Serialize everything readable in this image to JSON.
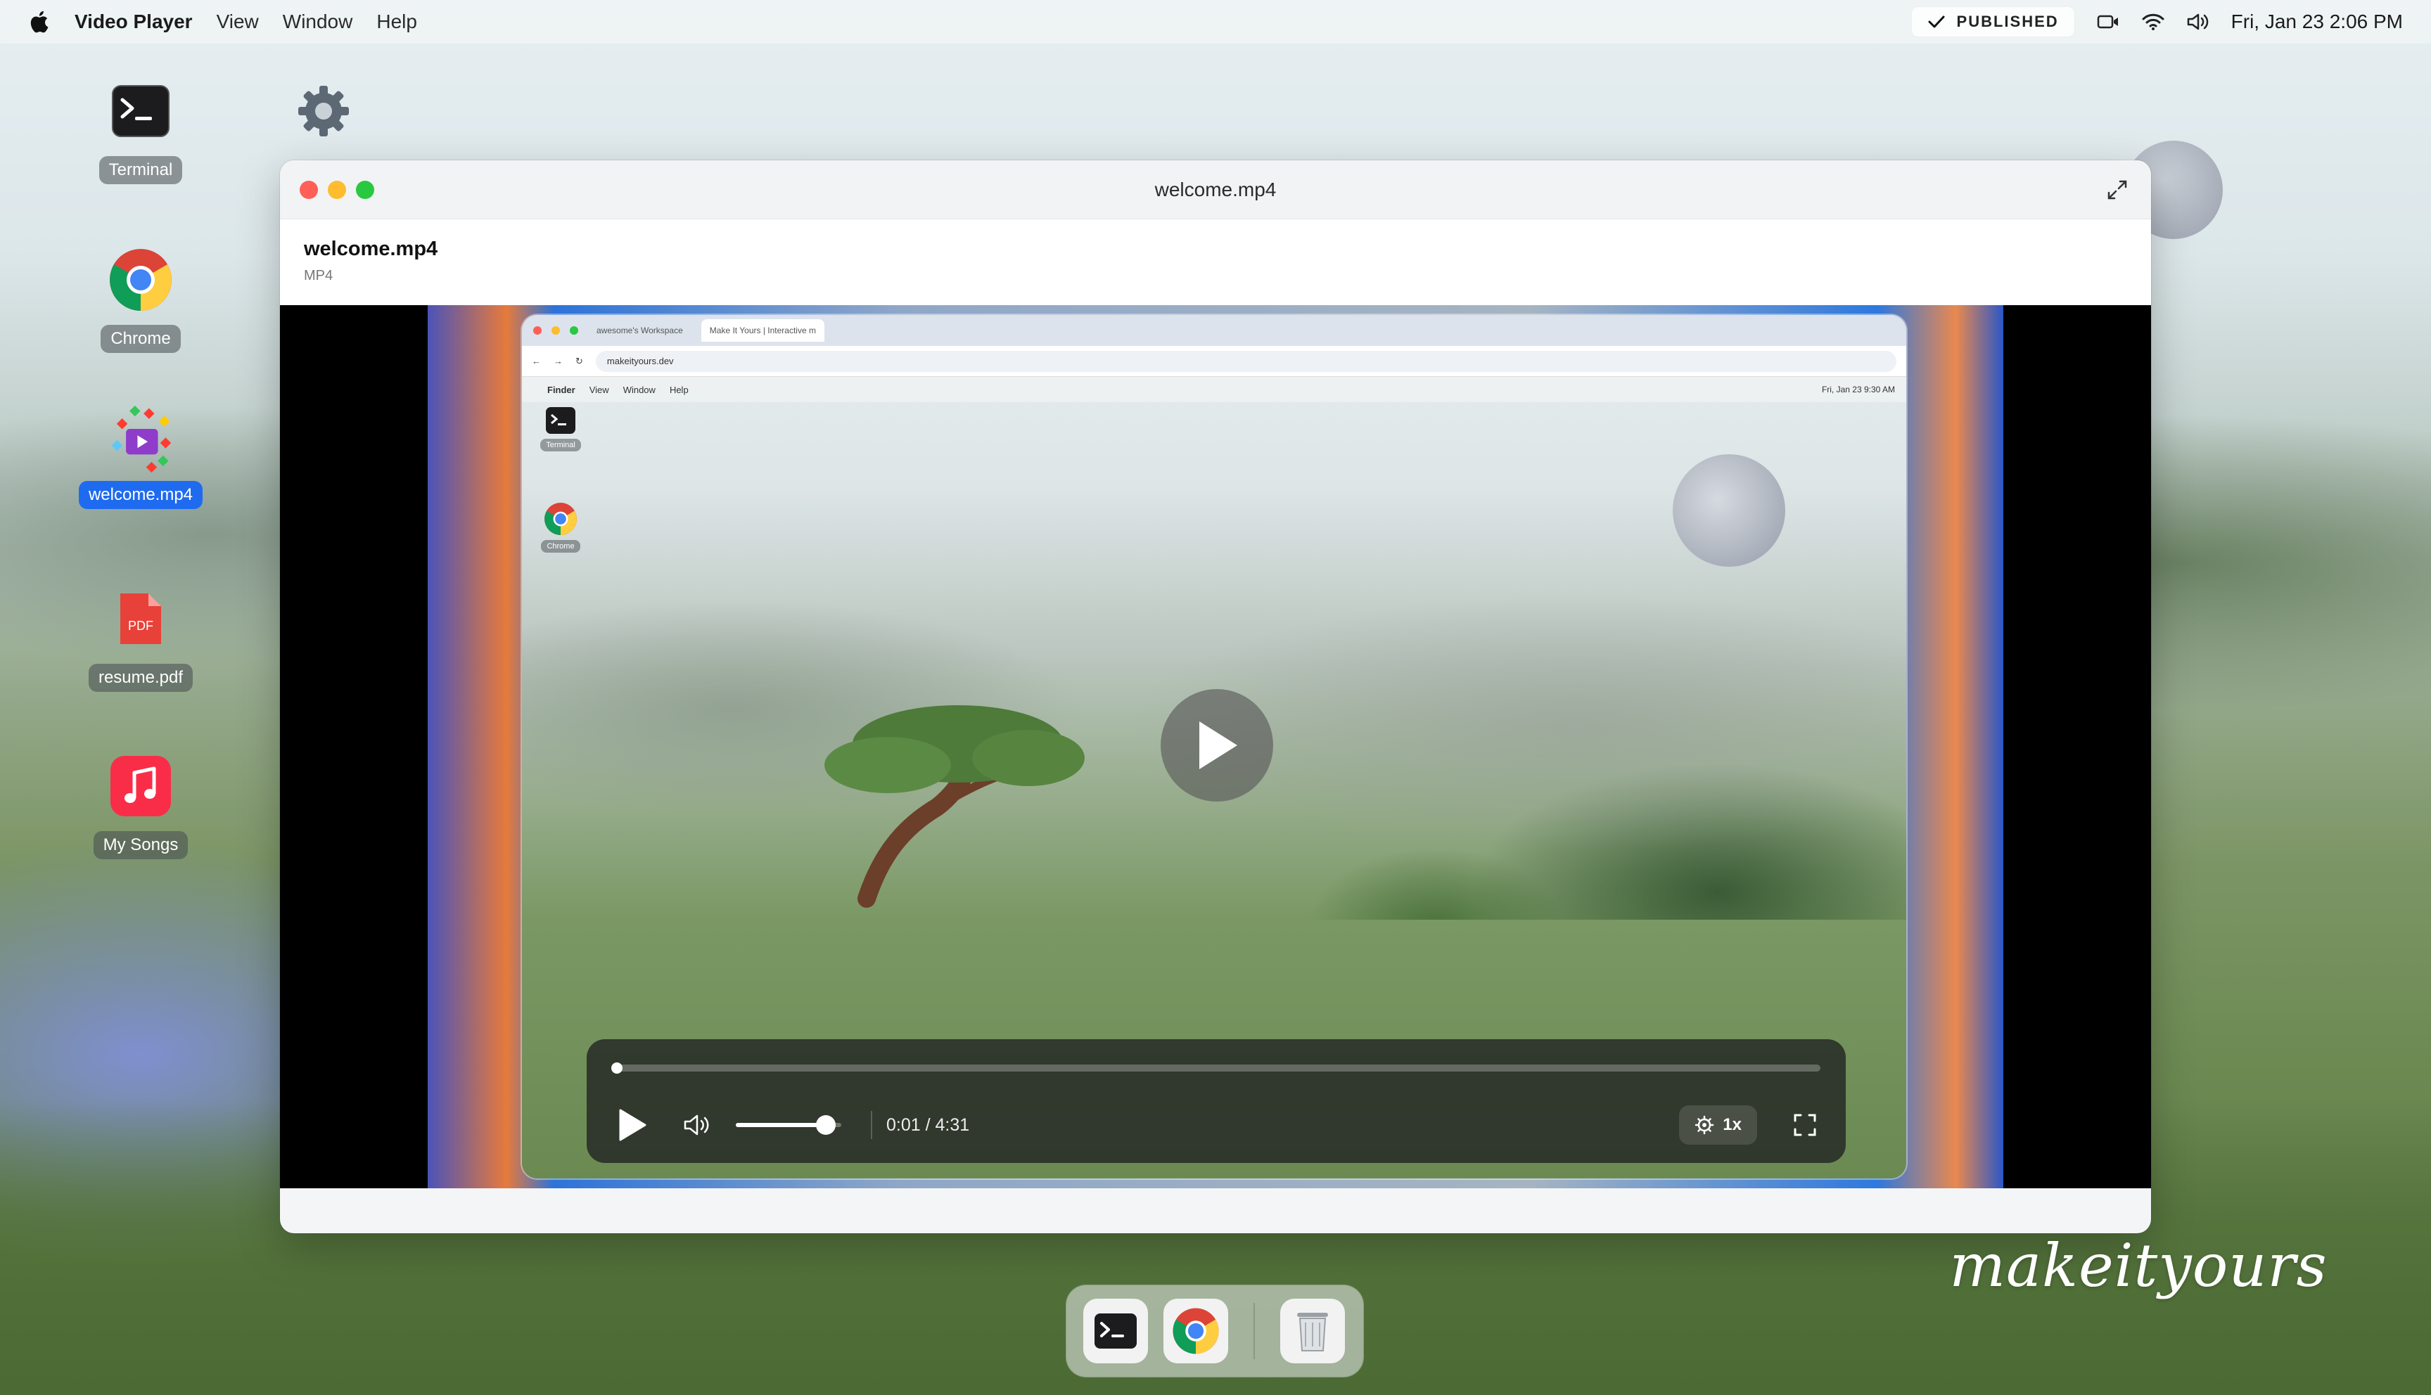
{
  "menubar": {
    "app_name": "Video Player",
    "menus": [
      "View",
      "Window",
      "Help"
    ],
    "publish_label": "PUBLISHED",
    "clock": "Fri, Jan 23  2:06 PM"
  },
  "desktop": {
    "icons": [
      {
        "label": "Terminal"
      },
      {
        "label": "Chrome"
      },
      {
        "label": "welcome.mp4"
      },
      {
        "label": "resume.pdf",
        "badge": "PDF"
      },
      {
        "label": "My Songs"
      }
    ]
  },
  "window": {
    "title": "welcome.mp4",
    "file_name": "welcome.mp4",
    "file_type": "MP4"
  },
  "video_content": {
    "tabs": [
      "awesome's Workspace",
      "Make It Yours | Interactive m"
    ],
    "url": "makeityours.dev",
    "menubar": [
      "Finder",
      "View",
      "Window",
      "Help"
    ],
    "clock": "Fri, Jan 23  9:30 AM",
    "icons": [
      "Terminal",
      "Chrome"
    ]
  },
  "player": {
    "time": "0:01 / 4:31",
    "progress": 0.004,
    "volume": 0.85,
    "speed": "1x"
  },
  "brand": "makeityours",
  "colors": {
    "accent": "#1f6bf0",
    "close": "#ff5f57",
    "minimize": "#febc2e",
    "maximize": "#28c840"
  }
}
